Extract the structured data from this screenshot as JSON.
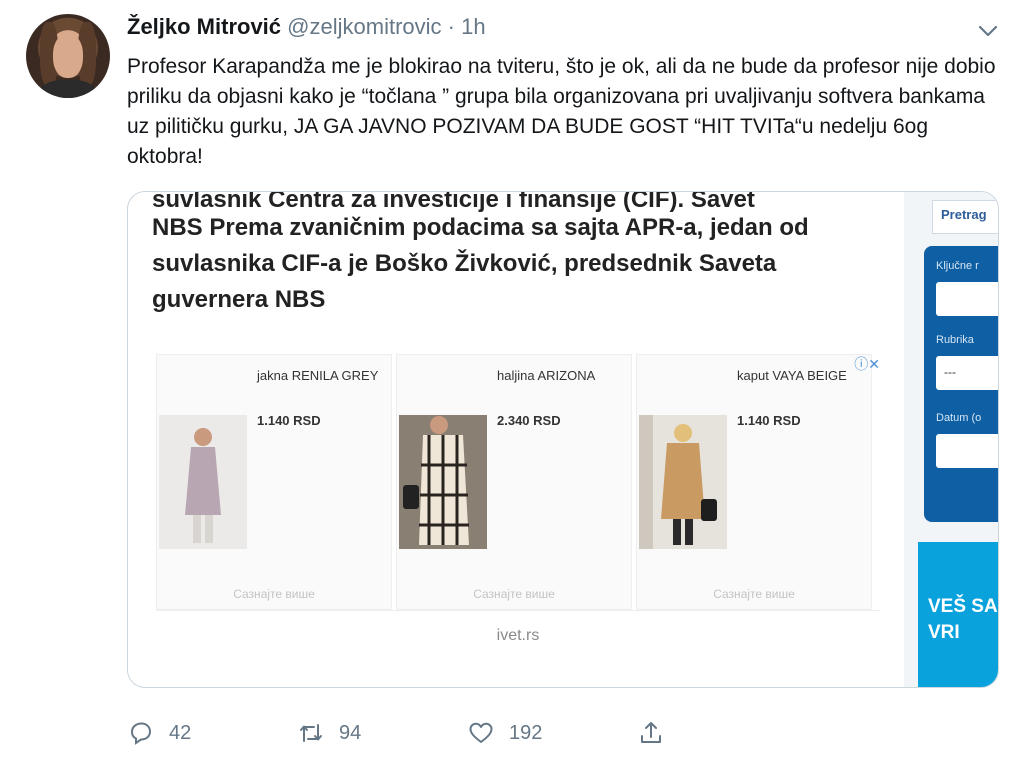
{
  "tweet": {
    "author_name": "Željko Mitrović",
    "handle": "@zeljkomitrovic",
    "separator": "·",
    "time": "1h",
    "text": "Profesor Karapandža me je blokirao na tviteru, što je ok, ali da ne bude da profesor nije dobio priliku da objasni kako je “točlana ” grupa bila organizovana pri uvaljivanju softvera bankama uz pilitičku gurku, JA GA JAVNO POZIVAM DA BUDE GOST “HIT TVITa“u nedelju 6og oktobra!"
  },
  "card": {
    "article_top_cut": "suvlasnik Centra za investicije i finansije (CIF). Savet",
    "article_body": "NBS Prema zvaničnim podacima sa sajta APR-a, jedan od suvlasnika CIF-a je Boško Živković, predsednik Saveta guvernera NBS",
    "ad_close": "ⓘ✕",
    "products": [
      {
        "title": "jakna RENILA GREY",
        "price": "1.140 RSD",
        "more": "Сазнајте више"
      },
      {
        "title": "haljina ARIZONA",
        "price": "2.340 RSD",
        "more": "Сазнајте више"
      },
      {
        "title": "kaput VAYA BEIGE",
        "price": "1.140 RSD",
        "more": "Сазнајте више"
      }
    ],
    "source": "ivet.rs",
    "sidebar": {
      "search_tab": "Pretrag",
      "keywords_label": "Ključne r",
      "section_label": "Rubrika",
      "section_value": "---",
      "date_label": "Datum (o",
      "banner_text": "VEŠ SA I VRI"
    }
  },
  "actions": {
    "replies": "42",
    "retweets": "94",
    "likes": "192"
  },
  "colors": {
    "text": "#14171a",
    "muted": "#657786",
    "card_border": "#ccd6dd",
    "panel_blue": "#0e5fa3",
    "banner_blue": "#0aa2dd"
  }
}
